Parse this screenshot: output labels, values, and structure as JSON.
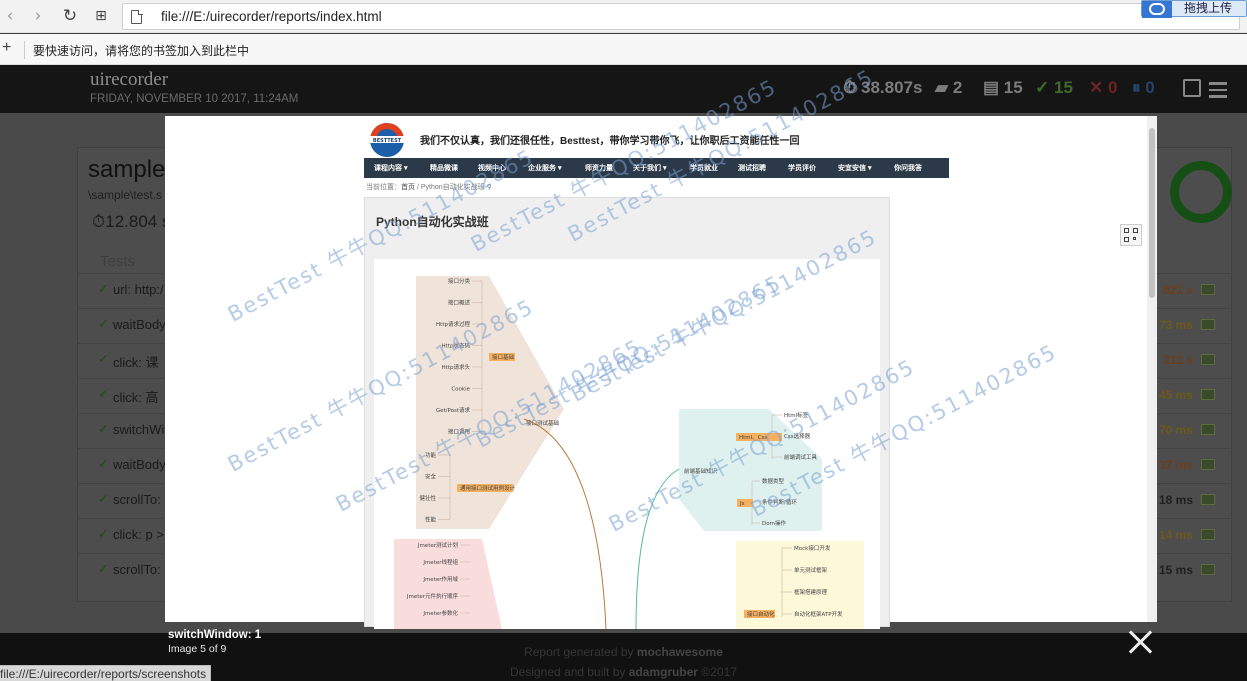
{
  "browser": {
    "url": "file:///E:/uirecorder/reports/index.html",
    "upload_label": "拖拽上传",
    "bookmark_hint": "要快速访问，请将您的书签加入到此栏中",
    "status_url": "file:///E:/uirecorder/reports/screenshots"
  },
  "report": {
    "brand": "uirecorder",
    "date": "FRIDAY, NOVEMBER 10 2017, 11:24AM",
    "stats": {
      "duration": "38.807s",
      "suites": "2",
      "tests": "15",
      "passes": "15",
      "failures": "0",
      "pending": "0"
    },
    "suite": {
      "title": "sample",
      "path": "\\sample\\test.s",
      "duration": "12.804 s",
      "tests_header": "Tests",
      "tests": [
        {
          "label": "url: http:/",
          "duration": "821 s",
          "color": "#6b3e1c"
        },
        {
          "label": "waitBody",
          "duration": "73 ms",
          "color": "#6b5a1c"
        },
        {
          "label": "click: 课",
          "duration": "211 s",
          "color": "#6b3e1c"
        },
        {
          "label": "click: 高",
          "duration": "45 ms",
          "color": "#6b5a1c"
        },
        {
          "label": "switchWi",
          "duration": "70 ms",
          "color": "#6b5a1c"
        },
        {
          "label": "waitBody",
          "duration": "37 ms",
          "color": "#6b3e1c"
        },
        {
          "label": "scrollTo:",
          "duration": "18 ms",
          "color": "#1f1f1f"
        },
        {
          "label": "click: p >",
          "duration": "14 ms",
          "color": "#6b5a1c"
        },
        {
          "label": "scrollTo:",
          "duration": "15 ms",
          "color": "#1f1f1f"
        }
      ]
    },
    "footer": {
      "generated_prefix": "Report generated by",
      "generator": "mochawesome",
      "designed_prefix": "Designed and built by",
      "author": "adamgruber",
      "year": "©2017"
    }
  },
  "lightbox": {
    "caption_title": "switchWindow: 1",
    "caption_counter": "Image 5 of 9",
    "site": {
      "logo_text": "BESTTEST",
      "slogan": "我们不仅认真，我们还很任性，Besttest，带你学习带你飞，让你职后工资能任性一回",
      "nav": [
        "课程内容 ▾",
        "精品微课",
        "视频中心",
        "企业服务 ▾",
        "师资力量",
        "关于我们 ▾",
        "学员就业",
        "测试招聘",
        "学员评价",
        "安宜安信 ▾",
        "你问我答"
      ],
      "breadcrumb_prefix": "当前位置：",
      "breadcrumb_home": "首页",
      "breadcrumb_page": "Python自动化实战班",
      "course_title": "Python自动化实战班"
    },
    "watermark": "BestTest 牛牛QQ:511402865",
    "mindmap": {
      "branch_interface": "接口基础",
      "branch_interface_items": [
        "接口分类",
        "接口概述",
        "Http请求过程",
        "Http状态码",
        "Http请求头",
        "Cookie",
        "Get/Post请求",
        "接口调用"
      ],
      "branch_design": "通用接口测试用例设计",
      "branch_design_items": [
        "功能",
        "安全",
        "健壮性",
        "性能"
      ],
      "node_center_left": "接口测试基础",
      "branch_jmeter_items": [
        "Jmeter测试计划",
        "Jmeter线程组",
        "Jmeter作用域",
        "Jmeter元件执行顺序",
        "Jmeter参数化"
      ],
      "node_web": "前端基础知识",
      "branch_html": "Html、Css",
      "branch_html_items": [
        "Html标签",
        "Css选择器",
        "前端调试工具"
      ],
      "branch_js": "Js",
      "branch_js_items": [
        "数据类型",
        "条件判断/循环",
        "Dom操作"
      ],
      "branch_auto": "接口自动化",
      "branch_auto_items": [
        "Mock接口开发",
        "单元测试框架",
        "框架搭建原理",
        "自动化框架ATP开发"
      ]
    }
  }
}
